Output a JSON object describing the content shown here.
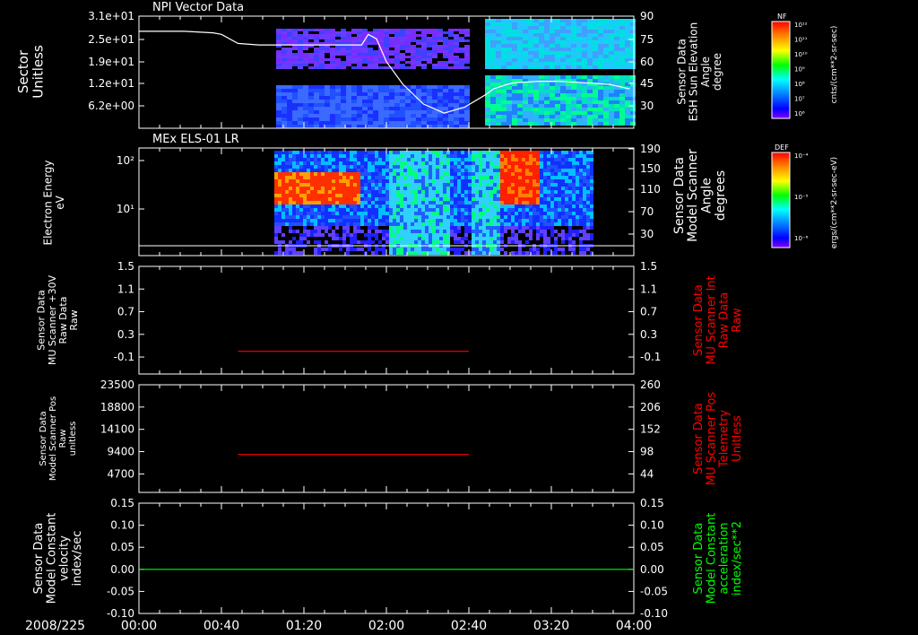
{
  "date_label": "2008/225",
  "time_ticks": [
    "00:00",
    "00:40",
    "01:20",
    "02:00",
    "02:40",
    "03:20",
    "04:00"
  ],
  "colors": {
    "axis": "#ffffff",
    "red": "#ff0000",
    "green": "#00ff00",
    "background": "#000000"
  },
  "chart_data": [
    {
      "type": "heatmap",
      "title": "NPI Vector Data",
      "ylabel": "Sector\nUnitless",
      "right_label": "Sensor Data\nESH Sun Elevation\nAngle\ndegree",
      "y_tick_labels": [
        "3.1e+01",
        "2.5e+01",
        "1.9e+01",
        "1.2e+01",
        "6.2e+00"
      ],
      "y2_tick_labels": [
        "90",
        "75",
        "60",
        "45",
        "30"
      ],
      "y2lim": [
        16,
        90
      ],
      "overlay_line": {
        "name": "ESH Sun Elevation Angle",
        "x_hours": [
          0.0,
          0.55,
          0.9,
          1.0,
          1.2,
          1.45,
          2.5,
          2.7,
          2.78,
          2.88,
          3.0,
          3.2,
          3.45,
          3.7,
          3.95,
          4.2,
          4.3,
          4.47,
          4.55,
          4.85,
          5.1,
          5.4,
          5.7,
          5.95
        ],
        "y_deg": [
          80,
          80,
          79,
          78,
          72,
          71,
          71,
          71,
          78,
          75,
          60,
          45,
          32,
          26,
          30,
          38,
          42,
          45,
          46,
          47,
          47,
          46,
          45,
          42
        ]
      },
      "colorbar": {
        "label": "NF",
        "units": "cnts/(cm**2-sr-sec)",
        "ticks": [
          "10¹²",
          "10¹¹",
          "10¹⁰",
          "10⁹",
          "10⁸",
          "10⁷",
          "10⁶"
        ]
      }
    },
    {
      "type": "heatmap",
      "title": "MEx ELS-01 LR",
      "ylabel": "Electron Energy\neV",
      "right_label": "Sensor Data\nModel Scanner\nAngle\ndegrees",
      "y_tick_labels": [
        "10²",
        "10¹"
      ],
      "y2_tick_labels": [
        "190",
        "150",
        "110",
        "70",
        "30"
      ],
      "colorbar": {
        "label": "DEF",
        "units": "ergs/(cm**2-sr-sec-eV)",
        "ticks": [
          "10⁻⁴",
          "10⁻⁵",
          "10⁻⁶"
        ]
      }
    },
    {
      "type": "line",
      "ylabel": "Sensor Data\nMU Scanner +30V\nRaw Data\nRaw",
      "right_label": "Sensor Data\nMU Scanner Int\nRaw Data\nRaw",
      "y_ticks": [
        1.5,
        1.1,
        0.7,
        0.3,
        -0.1
      ],
      "y_tick_labels": [
        "1.5",
        "1.1",
        "0.7",
        "0.3",
        "-0.1"
      ],
      "y2_tick_labels": [
        "1.5",
        "1.1",
        "0.7",
        "0.3",
        "-0.1"
      ],
      "ylim": [
        -0.4,
        1.5
      ],
      "series": [
        {
          "x_hours": [
            1.2,
            4.0
          ],
          "values": [
            0.0,
            0.0
          ]
        }
      ]
    },
    {
      "type": "line",
      "ylabel": "Sensor Data\nModel Scanner Pos\nRaw\nunitless",
      "right_label": "Sensor Data\nMU Scanner Pos\nTelemetry\nUnitless",
      "y_ticks": [
        23500,
        18800,
        14100,
        9400,
        4700
      ],
      "y_tick_labels": [
        "23500",
        "18800",
        "14100",
        "9400",
        "4700"
      ],
      "y2_tick_labels": [
        "260",
        "206",
        "152",
        "98",
        "44"
      ],
      "ylim": [
        800,
        23500
      ],
      "series": [
        {
          "x_hours": [
            1.2,
            4.0
          ],
          "values": [
            8800,
            8800
          ]
        }
      ]
    },
    {
      "type": "line",
      "ylabel": "Sensor Data\nModel Constant\nvelocity\nindex/sec",
      "right_label": "Sensor Data\nModel Constant\nacceleration\nindex/sec**2",
      "y_ticks": [
        0.15,
        0.1,
        0.05,
        0.0,
        -0.05,
        -0.1
      ],
      "y_tick_labels": [
        "0.15",
        "0.10",
        "0.05",
        "0.00",
        "-0.05",
        "-0.10"
      ],
      "y2_tick_labels": [
        "0.15",
        "0.10",
        "0.05",
        "0.00",
        "-0.05",
        "-0.10"
      ],
      "ylim": [
        -0.1,
        0.15
      ],
      "series": [
        {
          "x_hours": [
            0.0,
            4.0
          ],
          "values": [
            0.0,
            0.0
          ]
        }
      ]
    }
  ]
}
